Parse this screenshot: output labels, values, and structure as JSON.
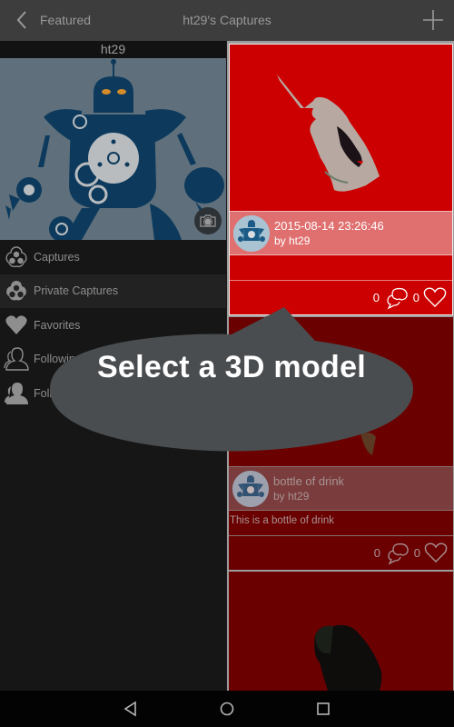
{
  "topbar": {
    "back_label": "Featured",
    "title": "ht29's Captures",
    "add_icon": "plus-icon",
    "back_icon": "chevron-left-icon"
  },
  "profile": {
    "username": "ht29",
    "camera_icon": "camera-icon"
  },
  "menu": {
    "items": [
      {
        "label": "Captures",
        "icon": "captures-icon"
      },
      {
        "label": "Private Captures",
        "icon": "private-captures-icon"
      },
      {
        "label": "Favorites",
        "icon": "heart-icon"
      },
      {
        "label": "Following",
        "icon": "person-outline-icon"
      },
      {
        "label": "Followers",
        "icon": "person-filled-icon"
      }
    ]
  },
  "feed": {
    "cards": [
      {
        "title": "2015-08-14 23:26:46",
        "author": "by ht29",
        "description": "",
        "comments": "0",
        "likes": "0"
      },
      {
        "title": "bottle of drink",
        "author": "by ht29",
        "description": "This is a bottle of drink",
        "comments": "0",
        "likes": "0"
      }
    ]
  },
  "overlay": {
    "text": "Select a 3D model"
  },
  "colors": {
    "card_active": "#cc0000",
    "card_dim": "#6b0000",
    "topbar": "#3d3d3d",
    "bubble": "#4a4d4f"
  }
}
